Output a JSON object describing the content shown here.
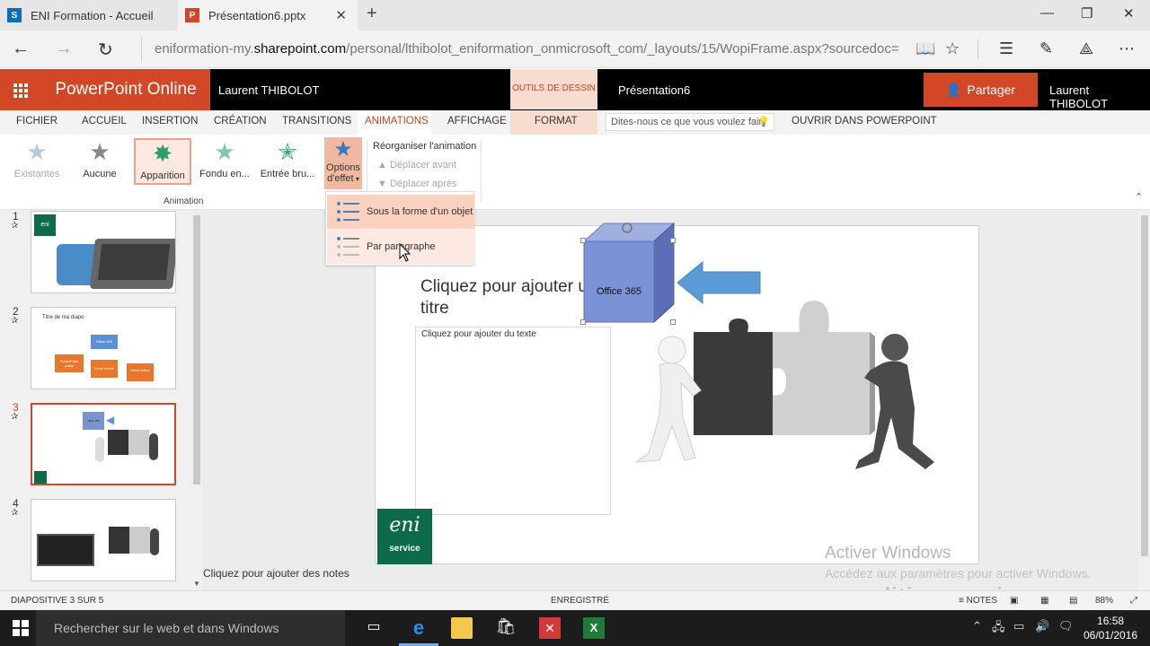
{
  "browser": {
    "tabs": [
      {
        "label": "ENI Formation - Accueil"
      },
      {
        "label": "Présentation6.pptx"
      }
    ],
    "url_prefix": "eniformation-my.",
    "url_domain": "sharepoint.com",
    "url_suffix": "/personal/lthibolot_eniformation_onmicrosoft_com/_layouts/15/WopiFrame.aspx?sourcedoc="
  },
  "office": {
    "app_name": "PowerPoint Online",
    "user_left": "Laurent THIBOLOT",
    "context_label": "OUTILS DE DESSIN",
    "file_name": "Présentation6",
    "share_label": "Partager",
    "user_right": "Laurent THIBOLOT"
  },
  "ribbon": {
    "tabs": [
      "FICHIER",
      "ACCUEIL",
      "INSERTION",
      "CRÉATION",
      "TRANSITIONS",
      "ANIMATIONS",
      "AFFICHAGE",
      "FORMAT",
      "OUVRIR DANS POWERPOINT"
    ],
    "active_tab": "ANIMATIONS",
    "tell_me_placeholder": "Dites-nous ce que vous voulez fair",
    "animations": [
      {
        "label": "Existantes",
        "state": "disabled"
      },
      {
        "label": "Aucune",
        "state": "normal"
      },
      {
        "label": "Apparition",
        "state": "selected"
      },
      {
        "label": "Fondu en...",
        "state": "normal"
      },
      {
        "label": "Entrée bru...",
        "state": "normal"
      }
    ],
    "effect_options_line1": "Options",
    "effect_options_line2": "d'effet",
    "group_label": "Animation",
    "reorder_title": "Réorganiser l'animation",
    "move_earlier": "Déplacer avant",
    "move_later": "Déplacer après"
  },
  "dropdown": {
    "items": [
      {
        "label": "Sous la forme d'un objet"
      },
      {
        "label": "Par paragraphe"
      }
    ]
  },
  "slides": [
    {
      "number": "1",
      "logo_text": "eni"
    },
    {
      "number": "2",
      "title": "Titre de ma diapo",
      "box1": "Office 365",
      "box2": "PowerPoint online",
      "box3": "Excel online",
      "box4": "Word online"
    },
    {
      "number": "3",
      "box": "Office 365"
    },
    {
      "number": "4"
    }
  ],
  "current_slide": {
    "title_placeholder": "Cliquez pour ajouter un titre",
    "body_placeholder": "Cliquez pour ajouter du texte",
    "cube_label": "Office 365",
    "logo_text": "eni",
    "logo_sub": "service"
  },
  "notes_placeholder": "Cliquez pour ajouter des notes",
  "watermark": {
    "line1": "Activer Windows",
    "line2": "Accédez aux paramètres pour activer Windows.",
    "brand": "editions eni.com"
  },
  "status": {
    "slide_info": "DIAPOSITIVE 3 SUR 5",
    "saved": "ENREGISTRÉ",
    "notes": "NOTES",
    "zoom": "88%"
  },
  "taskbar": {
    "search_placeholder": "Rechercher sur le web et dans Windows",
    "time": "16:58",
    "date": "06/01/2016"
  },
  "colors": {
    "brand": "#d24726",
    "ribbon_active": "#c4451d",
    "selected_anim_bg": "#fde9e1"
  }
}
